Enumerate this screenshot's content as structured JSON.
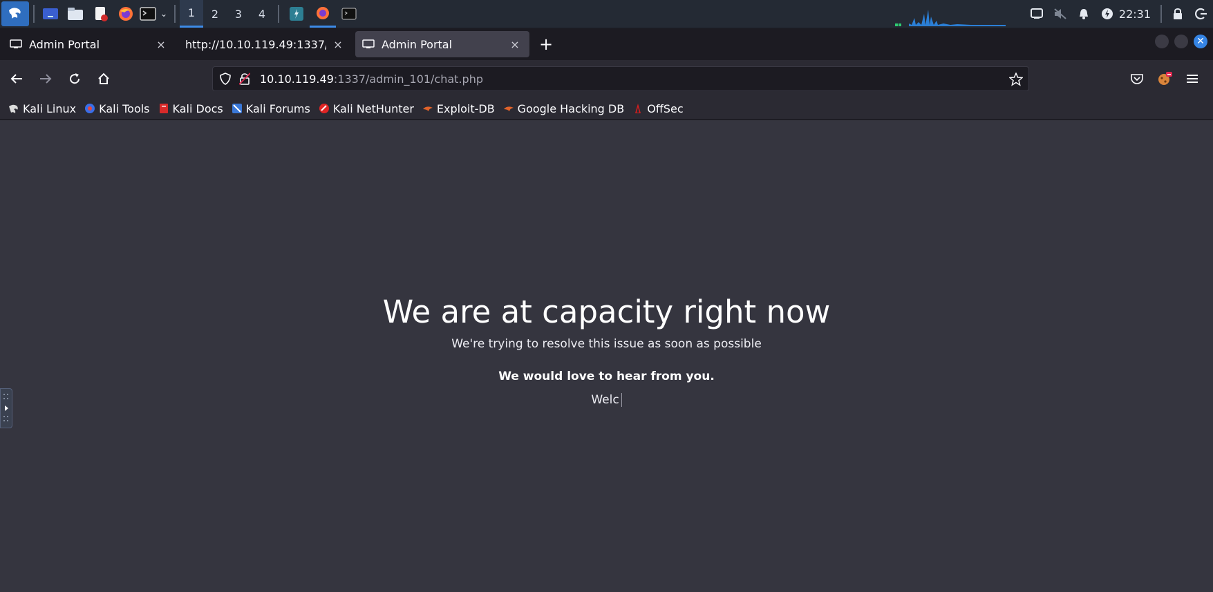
{
  "panel": {
    "workspaces": [
      "1",
      "2",
      "3",
      "4"
    ],
    "active_workspace": "1",
    "clock": "22:31"
  },
  "tabs": [
    {
      "label": "Admin Portal",
      "close": "×"
    },
    {
      "label": "http://10.10.119.49:1337/adm",
      "close": "×"
    },
    {
      "label": "Admin Portal",
      "close": "×"
    }
  ],
  "newtab_label": "+",
  "navbar": {
    "url_host": "10.10.119.49",
    "url_path": ":1337/admin_101/chat.php"
  },
  "bookmarks": [
    {
      "label": "Kali Linux",
      "icon": "kali-dragon-icon"
    },
    {
      "label": "Kali Tools",
      "icon": "kali-tools-icon"
    },
    {
      "label": "Kali Docs",
      "icon": "kali-docs-icon"
    },
    {
      "label": "Kali Forums",
      "icon": "kali-forums-icon"
    },
    {
      "label": "Kali NetHunter",
      "icon": "nethunter-icon"
    },
    {
      "label": "Exploit-DB",
      "icon": "exploit-db-icon"
    },
    {
      "label": "Google Hacking DB",
      "icon": "ghdb-icon"
    },
    {
      "label": "OffSec",
      "icon": "offsec-icon"
    }
  ],
  "page": {
    "headline": "We are at capacity right now",
    "subline": "We're trying to resolve this issue as soon as possible",
    "love": "We would love to hear from you.",
    "typing": "Welc"
  },
  "colors": {
    "accent": "#3d8be8",
    "page_bg": "#35353f",
    "tab_strip": "#1c1b22",
    "toolbar": "#2b2a33"
  }
}
